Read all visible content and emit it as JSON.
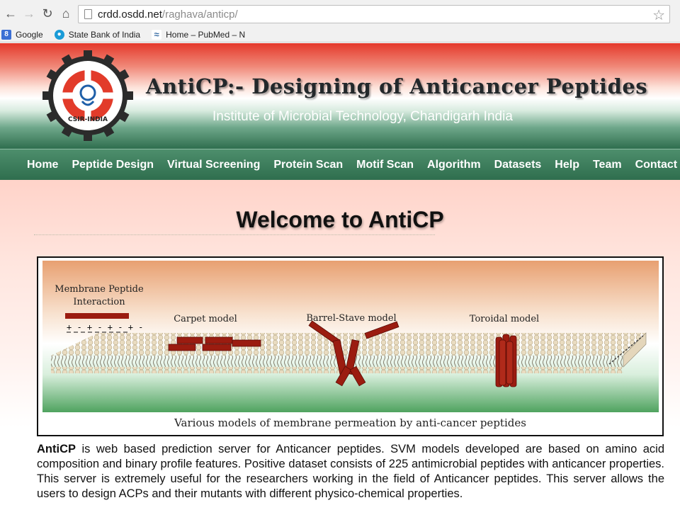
{
  "browser": {
    "url_host": "crdd.osdd.net",
    "url_path": "/raghava/anticp/",
    "bookmarks": [
      {
        "label": "Google",
        "icon": "google-icon",
        "color": "#3b6fd4"
      },
      {
        "label": "State Bank of India",
        "icon": "sbi-icon",
        "color": "#1a9bd7"
      },
      {
        "label": "Home – PubMed – N",
        "icon": "pubmed-icon",
        "color": "#3a6ea5"
      }
    ]
  },
  "header": {
    "title": "AntiCP:- Designing of Anticancer Peptides",
    "subtitle": "Institute of Microbial Technology, Chandigarh India",
    "emblem_label": "CSIR-INDIA"
  },
  "nav": {
    "items": [
      {
        "label": "Home"
      },
      {
        "label": "Peptide Design"
      },
      {
        "label": "Virtual Screening"
      },
      {
        "label": "Protein Scan"
      },
      {
        "label": "Motif Scan"
      },
      {
        "label": "Algorithm"
      },
      {
        "label": "Datasets"
      },
      {
        "label": "Help"
      },
      {
        "label": "Team"
      },
      {
        "label": "Contact Us"
      }
    ]
  },
  "main": {
    "heading": "Welcome to AntiCP",
    "figure": {
      "label_interaction_1": "Membrane Peptide",
      "label_interaction_2": "Interaction",
      "label_carpet": "Carpet model",
      "label_barrel": "Barrel-Stave model",
      "label_toroidal": "Toroidal  model",
      "charges": "+ - + - + - + -",
      "caption": "Various models of membrane permeation by anti-cancer peptides"
    },
    "intro_bold": "AntiCP",
    "intro_text": " is web based prediction server for Anticancer peptides. SVM models developed are based on amino acid composition and binary profile features. Positive dataset consists of 225 antimicrobial peptides with anticancer properties. This server is extremely useful for the researchers working in the field of Anticancer peptides. This server allows the users to design ACPs and their mutants with different physico-chemical properties."
  },
  "colors": {
    "header_red": "#e4392b",
    "header_green": "#2f6e4e",
    "nav_green": "#3f7f5d",
    "peptide_red": "#9b1c10",
    "content_bg": "#ffd3c9"
  }
}
